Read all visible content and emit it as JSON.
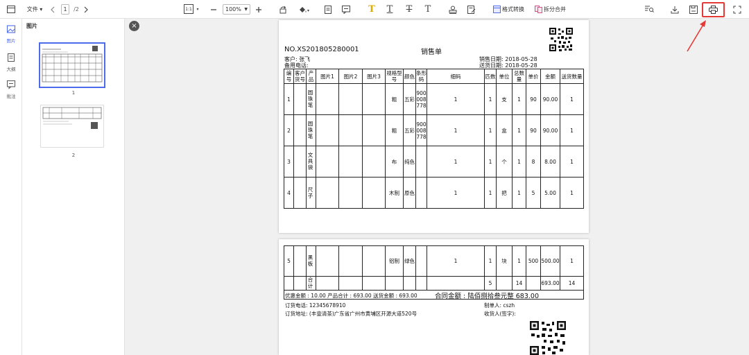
{
  "toolbar": {
    "file_label": "文件 ▾",
    "page_current": "1",
    "page_total": "/2",
    "fit_label": "1:1",
    "zoom": "100%",
    "format_convert": "格式转换",
    "split_merge": "拆分合并",
    "accent": "#4f6bed",
    "highlight": "#e53935"
  },
  "sidebar": {
    "items": [
      {
        "label": "图片",
        "icon": "image-icon"
      },
      {
        "label": "大纲",
        "icon": "outline-icon"
      },
      {
        "label": "批注",
        "icon": "comment-icon"
      }
    ]
  },
  "thumbpanel": {
    "title": "图片",
    "thumbs": [
      {
        "num": "1"
      },
      {
        "num": "2"
      }
    ]
  },
  "doc": {
    "order_no": "NO.XS201805280001",
    "title": "销售单",
    "customer": "客户: 张飞",
    "phone": "备用电话:",
    "sale_date": "销售日期: 2018-05-28",
    "ship_date": "送货日期: 2018-05-28",
    "headers": [
      "编号",
      "客户货号",
      "产品",
      "图片1",
      "图片2",
      "图片3",
      "规格型号",
      "颜色",
      "条形码",
      "细码",
      "匹数",
      "单位",
      "总数量",
      "单价",
      "金额",
      "送货数量"
    ],
    "rows": [
      {
        "no": "1",
        "product": "圆珠笔",
        "spec": "粗",
        "color": "五彩",
        "barcode": "900008778",
        "size": "1",
        "pcs": "1",
        "unit": "支",
        "qty": "1",
        "price": "90",
        "amount": "90.00",
        "ship": "1"
      },
      {
        "no": "2",
        "product": "圆珠笔",
        "spec": "粗",
        "color": "五彩",
        "barcode": "900008778",
        "size": "1",
        "pcs": "1",
        "unit": "盒",
        "qty": "1",
        "price": "90",
        "amount": "90.00",
        "ship": "1"
      },
      {
        "no": "3",
        "product": "文具袋",
        "spec": "布",
        "color": "纯色",
        "barcode": "",
        "size": "1",
        "pcs": "1",
        "unit": "个",
        "qty": "1",
        "price": "8",
        "amount": "8.00",
        "ship": "1"
      },
      {
        "no": "4",
        "product": "尺子",
        "spec": "木制",
        "color": "原色",
        "barcode": "",
        "size": "1",
        "pcs": "1",
        "unit": "把",
        "qty": "1",
        "price": "5",
        "amount": "5.00",
        "ship": "1"
      }
    ],
    "row5": {
      "no": "5",
      "product": "黑板",
      "spec": "铝制",
      "color": "绿色",
      "size": "1",
      "pcs": "1",
      "unit": "块",
      "qty": "1",
      "price": "500",
      "amount": "500.00",
      "ship": "1"
    },
    "total": {
      "label": "合计",
      "pcs": "5",
      "qty": "14",
      "amount": "693.00",
      "ship": "14"
    },
    "summary": "优惠金额 : 10.00 产品合计 : 693.00 送货金额 : 693.00",
    "contract": "合同金额 : 陆佰捌拾叁元整 683.00",
    "order_phone": "订货电话: 12345678910",
    "order_addr": "订货地址: (丰壹清茶)广东省广州市黄埔区开源大道520号",
    "maker": "制单人: cszh",
    "receiver": "收货人(签字):"
  }
}
